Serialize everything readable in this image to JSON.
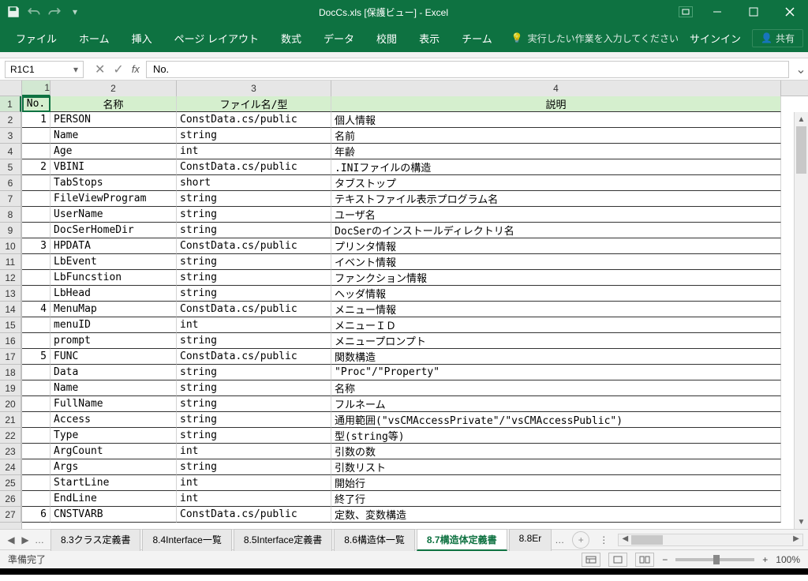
{
  "title": "DocCs.xls [保護ビュー] - Excel",
  "ribbon": {
    "tabs": [
      "ファイル",
      "ホーム",
      "挿入",
      "ページ レイアウト",
      "数式",
      "データ",
      "校閲",
      "表示",
      "チーム"
    ],
    "tellme": "実行したい作業を入力してください",
    "signin": "サインイン",
    "share": "共有"
  },
  "formula": {
    "namebox": "R1C1",
    "value": "No."
  },
  "columns": {
    "c1": "1",
    "c2": "2",
    "c3": "3",
    "c4": "4"
  },
  "headers": {
    "no": "No.",
    "name": "名称",
    "file": "ファイル名/型",
    "desc": "説明"
  },
  "rows": [
    {
      "r": "1",
      "no": "",
      "n": "",
      "f": "",
      "d": "",
      "hdr": true
    },
    {
      "r": "2",
      "no": "1",
      "n": "PERSON",
      "f": "ConstData.cs/public",
      "d": "個人情報"
    },
    {
      "r": "3",
      "no": "",
      "n": "Name",
      "f": "string",
      "d": "名前"
    },
    {
      "r": "4",
      "no": "",
      "n": "Age",
      "f": "int",
      "d": "年齢"
    },
    {
      "r": "5",
      "no": "2",
      "n": "VBINI",
      "f": "ConstData.cs/public",
      "d": ".INIファイルの構造"
    },
    {
      "r": "6",
      "no": "",
      "n": "TabStops",
      "f": "short",
      "d": "タブストップ"
    },
    {
      "r": "7",
      "no": "",
      "n": "FileViewProgram",
      "f": "string",
      "d": "テキストファイル表示プログラム名"
    },
    {
      "r": "8",
      "no": "",
      "n": "UserName",
      "f": "string",
      "d": "ユーザ名"
    },
    {
      "r": "9",
      "no": "",
      "n": "DocSerHomeDir",
      "f": "string",
      "d": "DocSerのインストールディレクトリ名"
    },
    {
      "r": "10",
      "no": "3",
      "n": "HPDATA",
      "f": "ConstData.cs/public",
      "d": "プリンタ情報"
    },
    {
      "r": "11",
      "no": "",
      "n": "LbEvent",
      "f": "string",
      "d": "イベント情報"
    },
    {
      "r": "12",
      "no": "",
      "n": "LbFuncstion",
      "f": "string",
      "d": "ファンクション情報"
    },
    {
      "r": "13",
      "no": "",
      "n": "LbHead",
      "f": "string",
      "d": "ヘッダ情報"
    },
    {
      "r": "14",
      "no": "4",
      "n": "MenuMap",
      "f": "ConstData.cs/public",
      "d": "メニュー情報"
    },
    {
      "r": "15",
      "no": "",
      "n": "menuID",
      "f": "int",
      "d": "メニューＩＤ"
    },
    {
      "r": "16",
      "no": "",
      "n": "prompt",
      "f": "string",
      "d": "メニュープロンプト"
    },
    {
      "r": "17",
      "no": "5",
      "n": "FUNC",
      "f": "ConstData.cs/public",
      "d": "関数構造"
    },
    {
      "r": "18",
      "no": "",
      "n": "Data",
      "f": "string",
      "d": "\"Proc\"/\"Property\""
    },
    {
      "r": "19",
      "no": "",
      "n": "Name",
      "f": "string",
      "d": "名称"
    },
    {
      "r": "20",
      "no": "",
      "n": "FullName",
      "f": "string",
      "d": "フルネーム"
    },
    {
      "r": "21",
      "no": "",
      "n": "Access",
      "f": "string",
      "d": "通用範囲(\"vsCMAccessPrivate\"/\"vsCMAccessPublic\")"
    },
    {
      "r": "22",
      "no": "",
      "n": "Type",
      "f": "string",
      "d": "型(string等)"
    },
    {
      "r": "23",
      "no": "",
      "n": "ArgCount",
      "f": "int",
      "d": "引数の数"
    },
    {
      "r": "24",
      "no": "",
      "n": "Args",
      "f": "string",
      "d": "引数リスト"
    },
    {
      "r": "25",
      "no": "",
      "n": "StartLine",
      "f": "int",
      "d": "開始行"
    },
    {
      "r": "26",
      "no": "",
      "n": "EndLine",
      "f": "int",
      "d": "終了行"
    },
    {
      "r": "27",
      "no": "6",
      "n": "CNSTVARB",
      "f": "ConstData.cs/public",
      "d": "定数、変数構造"
    }
  ],
  "sheets": [
    "8.3クラス定義書",
    "8.4Interface一覧",
    "8.5Interface定義書",
    "8.6構造体一覧",
    "8.7構造体定義書",
    "8.8Er"
  ],
  "active_sheet": 4,
  "status": {
    "ready": "準備完了",
    "zoom": "100%"
  }
}
